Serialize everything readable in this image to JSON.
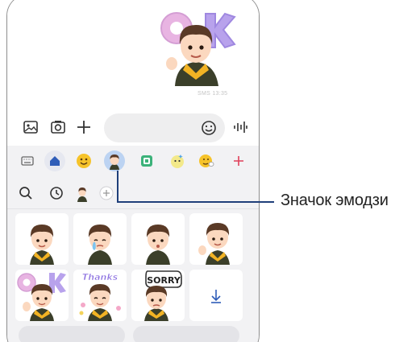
{
  "chat": {
    "timestamp": "SMS 13:35"
  },
  "keyboard": {
    "tabs": [
      {
        "icon": "keyboard-icon"
      },
      {
        "icon": "home-icon"
      },
      {
        "icon": "emoji-icon"
      },
      {
        "icon": "ar-emoji-icon",
        "selected": true
      },
      {
        "icon": "sticker-icon"
      },
      {
        "icon": "bitmoji-icon"
      },
      {
        "icon": "mojitok-icon"
      },
      {
        "icon": "add-icon"
      }
    ],
    "sub_tabs": [
      {
        "icon": "search-icon"
      },
      {
        "icon": "recent-icon"
      },
      {
        "icon": "avatar-icon"
      },
      {
        "icon": "add-icon"
      }
    ],
    "sticker_texts": {
      "thanks": "Thanks",
      "sorry": "SORRY"
    }
  },
  "callout": {
    "label": "Значок эмодзи"
  },
  "colors": {
    "accent": "#1f3f7a",
    "selected_tab": "#bcd3f2",
    "add_tab": "#e0405a"
  }
}
